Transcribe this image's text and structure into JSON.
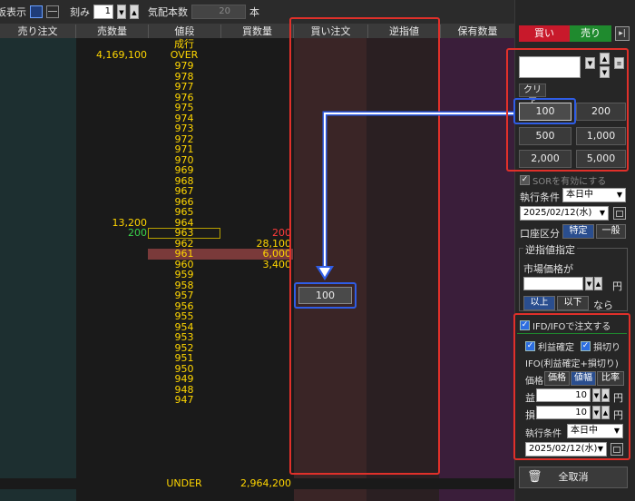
{
  "topbar": {
    "view_label": "板表示",
    "tick_label": "刻み",
    "tick_value": "1",
    "quote_count_label": "気配本数",
    "quote_count_value": "20",
    "quote_unit": "本"
  },
  "board": {
    "headers": [
      "売り注文",
      "売数量",
      "値段",
      "買数量",
      "買い注文",
      "逆指値",
      "保有数量"
    ],
    "market_label": "成行",
    "over_label": "OVER",
    "over_sell_qty": "4,169,100",
    "under_label": "UNDER",
    "under_buy_qty": "2,964,200",
    "rows": [
      {
        "price": "979",
        "sell": "",
        "buy": ""
      },
      {
        "price": "978",
        "sell": "",
        "buy": ""
      },
      {
        "price": "977",
        "sell": "",
        "buy": ""
      },
      {
        "price": "976",
        "sell": "",
        "buy": ""
      },
      {
        "price": "975",
        "sell": "",
        "buy": ""
      },
      {
        "price": "974",
        "sell": "",
        "buy": ""
      },
      {
        "price": "973",
        "sell": "",
        "buy": ""
      },
      {
        "price": "972",
        "sell": "",
        "buy": ""
      },
      {
        "price": "971",
        "sell": "",
        "buy": ""
      },
      {
        "price": "970",
        "sell": "",
        "buy": ""
      },
      {
        "price": "969",
        "sell": "",
        "buy": ""
      },
      {
        "price": "968",
        "sell": "",
        "buy": ""
      },
      {
        "price": "967",
        "sell": "",
        "buy": ""
      },
      {
        "price": "966",
        "sell": "",
        "buy": ""
      },
      {
        "price": "965",
        "sell": "",
        "buy": ""
      },
      {
        "price": "964",
        "sell": "13,200",
        "buy": ""
      },
      {
        "price": "963",
        "sell": "200",
        "buy": "200"
      },
      {
        "price": "962",
        "sell": "",
        "buy": "28,100"
      },
      {
        "price": "961",
        "sell": "",
        "buy": "6,000"
      },
      {
        "price": "960",
        "sell": "",
        "buy": "3,400"
      },
      {
        "price": "959",
        "sell": "",
        "buy": ""
      },
      {
        "price": "958",
        "sell": "",
        "buy": ""
      },
      {
        "price": "957",
        "sell": "",
        "buy": ""
      },
      {
        "price": "956",
        "sell": "",
        "buy": ""
      },
      {
        "price": "955",
        "sell": "",
        "buy": ""
      },
      {
        "price": "954",
        "sell": "",
        "buy": ""
      },
      {
        "price": "953",
        "sell": "",
        "buy": ""
      },
      {
        "price": "952",
        "sell": "",
        "buy": ""
      },
      {
        "price": "951",
        "sell": "",
        "buy": ""
      },
      {
        "price": "950",
        "sell": "",
        "buy": ""
      },
      {
        "price": "949",
        "sell": "",
        "buy": ""
      },
      {
        "price": "948",
        "sell": "",
        "buy": ""
      },
      {
        "price": "947",
        "sell": "",
        "buy": ""
      }
    ],
    "drop_order_qty": "100"
  },
  "order": {
    "buy_tab": "買い",
    "sell_tab": "売り",
    "clear_label": "クリア",
    "qty_buttons": [
      "100",
      "200",
      "500",
      "1,000",
      "2,000",
      "5,000"
    ],
    "sor_label": "SORを有効にする",
    "exec_label": "執行条件",
    "exec_value": "本日中",
    "date_value": "2025/02/12(水)",
    "account_label": "口座区分",
    "account_specific": "特定",
    "account_general": "一般",
    "stop_title": "逆指値指定",
    "market_price_label": "市場価格が",
    "yen": "円",
    "above_label": "以上",
    "below_label": "以下",
    "then_label": "なら",
    "ifd_label": "IFD/IFOで注文する",
    "profit_label": "利益確定",
    "loss_label": "損切り",
    "ifo_label": "IFO(利益確定+損切り)",
    "price_label": "価格",
    "price_opt1": "価格",
    "price_opt2": "値幅",
    "price_opt3": "比率",
    "gain_label": "益",
    "loss_short": "損",
    "gain_value": "10",
    "loss_value": "10",
    "exec2_label": "執行条件",
    "exec2_value": "本日中",
    "date2_value": "2025/02/12(水)",
    "cancel_all": "全取消"
  },
  "colors": {
    "highlight_red": "#e0302a",
    "highlight_blue": "#2f5de6",
    "buy": "#c8192b",
    "sell": "#1f8a2e"
  }
}
